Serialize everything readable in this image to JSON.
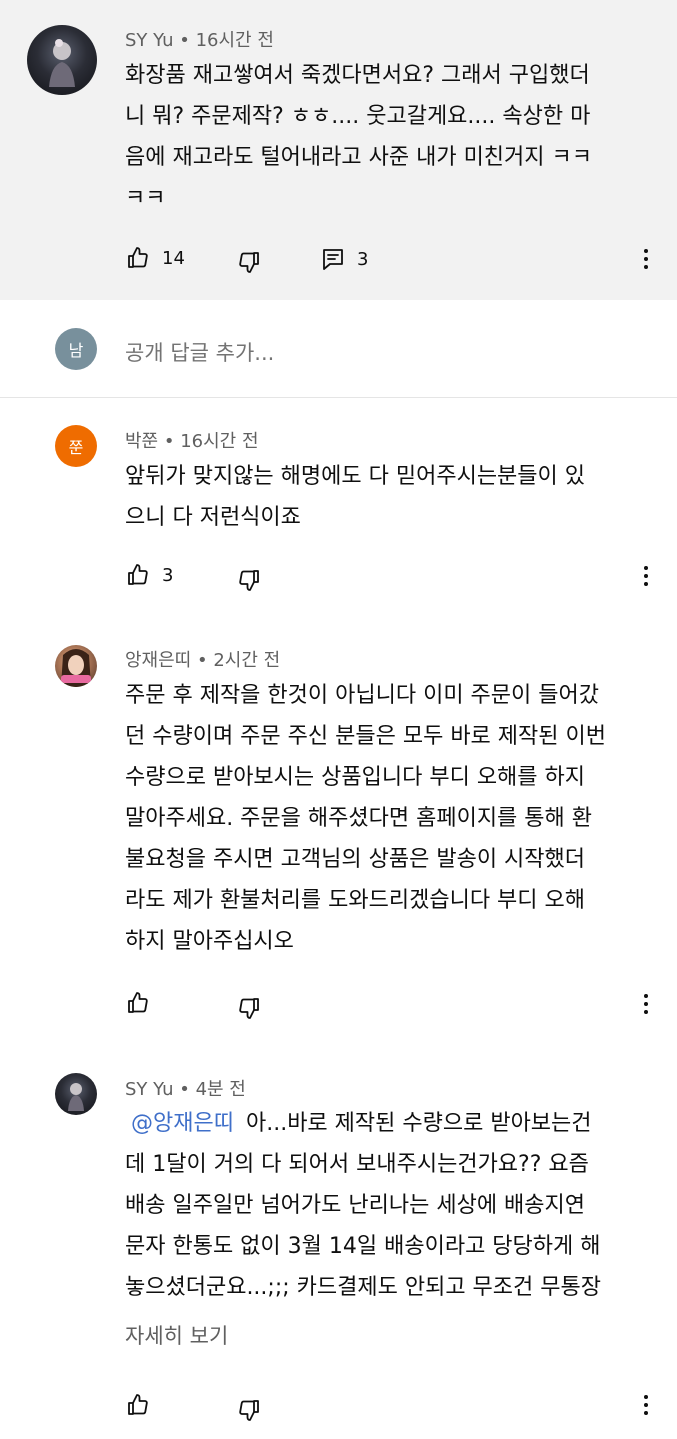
{
  "comments": [
    {
      "author": "SY Yu",
      "time": "16시간 전",
      "lines": [
        "화장품 재고쌓여서 죽겠다면서요? 그래서 구입했더",
        "니 뭐? 주문제작?  ㅎㅎ.... 웃고갈게요.... 속상한 마",
        "음에 재고라도 털어내라고 사준 내가 미친거지 ㅋㅋ",
        "ㅋㅋ"
      ],
      "likes": "14",
      "replies": "3"
    },
    {
      "author": "박쭌",
      "avatar_letter": "쭌",
      "avatar_color": "#ef6c00",
      "time": "16시간 전",
      "lines": [
        "앞뒤가 맞지않는 해명에도 다 믿어주시는분들이 있",
        "으니 다 저런식이죠"
      ],
      "likes": "3"
    },
    {
      "author": "앙재은띠",
      "time": "2시간 전",
      "lines": [
        "주문 후 제작을 한것이 아닙니다 이미 주문이 들어갔",
        "던 수량이며 주문 주신 분들은 모두 바로 제작된 이번",
        "수량으로 받아보시는 상품입니다 부디 오해를 하지",
        "말아주세요. 주문을 해주셨다면 홈페이지를 통해 환",
        "불요청을 주시면 고객님의 상품은 발송이 시작했더",
        "라도 제가 환불처리를 도와드리겠습니다 부디 오해",
        "하지 말아주십시오"
      ]
    },
    {
      "author": "SY Yu",
      "time": "4분 전",
      "mention": "@앙재은띠",
      "first_line_rest": "아...바로 제작된 수량으로 받아보는건",
      "lines": [
        "데 1달이 거의 다 되어서 보내주시는건가요?? 요즘",
        "배송 일주일만 넘어가도 난리나는 세상에 배송지연",
        "문자 한통도 없이 3월 14일 배송이라고 당당하게 해",
        "놓으셨더군요...;;; 카드결제도 안되고 무조건 무통장"
      ],
      "read_more": "자세히 보기"
    }
  ],
  "reply_box": {
    "avatar_letter": "남",
    "avatar_color": "#78909c",
    "placeholder": "공개 답글 추가..."
  },
  "separator": "•"
}
